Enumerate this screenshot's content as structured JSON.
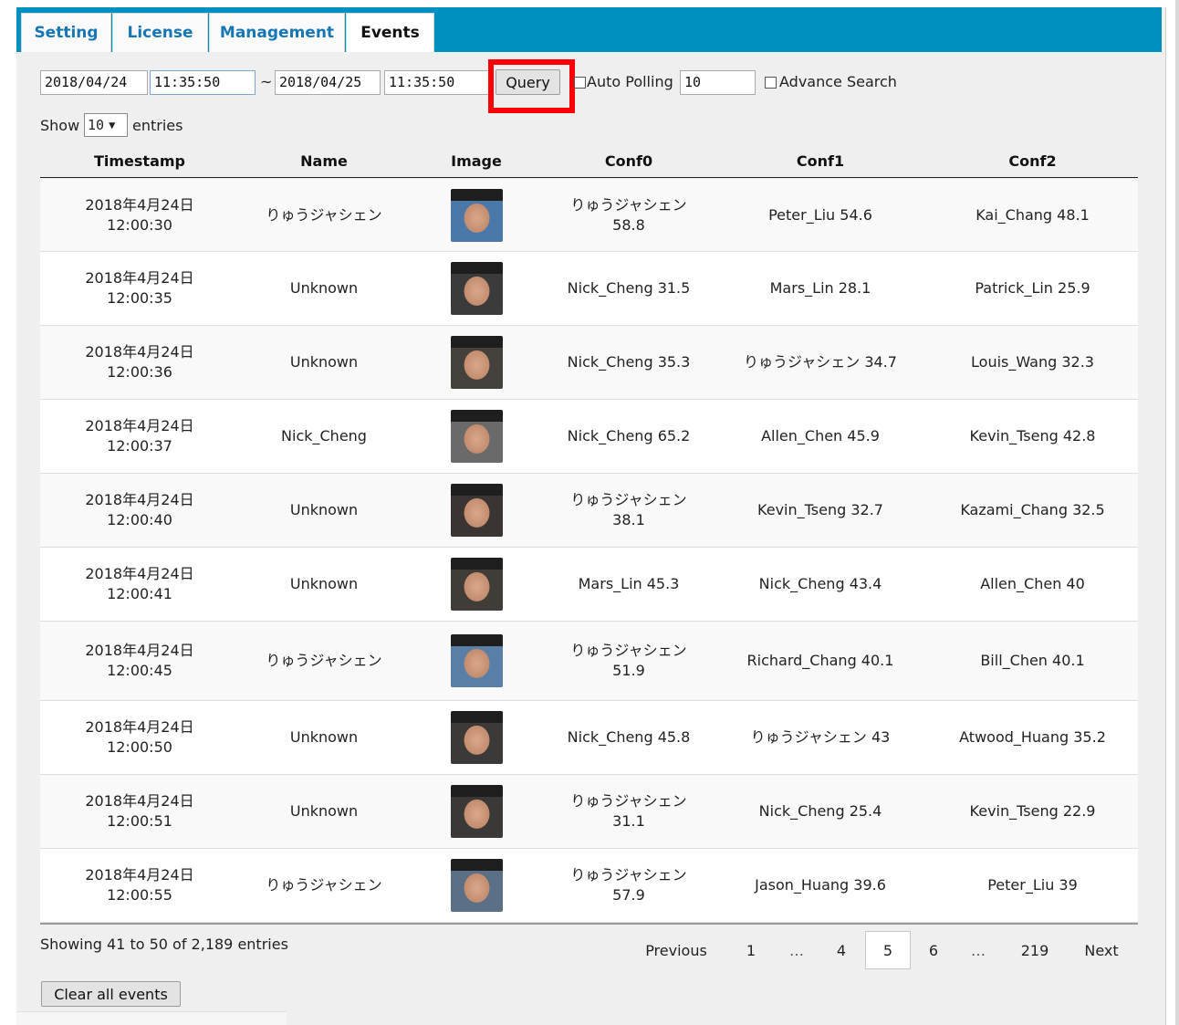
{
  "tabs": [
    {
      "label": "Setting",
      "active": false
    },
    {
      "label": "License",
      "active": false
    },
    {
      "label": "Management",
      "active": false
    },
    {
      "label": "Events",
      "active": true
    }
  ],
  "filters": {
    "start_date": "2018/04/24",
    "start_time": "11:35:50",
    "separator": "~",
    "end_date": "2018/04/25",
    "end_time": "11:35:50",
    "query_label": "Query",
    "auto_polling_label": "Auto Polling",
    "auto_polling_checked": false,
    "auto_polling_value": "10",
    "advance_search_label": "Advance Search",
    "advance_search_checked": false
  },
  "length_menu": {
    "show_label": "Show",
    "selected": "10",
    "entries_label": "entries"
  },
  "table": {
    "columns": [
      "Timestamp",
      "Name",
      "Image",
      "Conf0",
      "Conf1",
      "Conf2"
    ],
    "rows": [
      {
        "date": "2018年4月24日",
        "time": "12:00:30",
        "name": "りゅうジャシェン",
        "face_color": "#4a78a8",
        "conf0": "りゅうジャシェン\n58.8",
        "conf1": "Peter_Liu 54.6",
        "conf2": "Kai_Chang 48.1"
      },
      {
        "date": "2018年4月24日",
        "time": "12:00:35",
        "name": "Unknown",
        "face_color": "#3b3b3b",
        "conf0": "Nick_Cheng 31.5",
        "conf1": "Mars_Lin 28.1",
        "conf2": "Patrick_Lin 25.9"
      },
      {
        "date": "2018年4月24日",
        "time": "12:00:36",
        "name": "Unknown",
        "face_color": "#44413c",
        "conf0": "Nick_Cheng 35.3",
        "conf1": "りゅうジャシェン 34.7",
        "conf2": "Louis_Wang 32.3"
      },
      {
        "date": "2018年4月24日",
        "time": "12:00:37",
        "name": "Nick_Cheng",
        "face_color": "#6a6a6a",
        "conf0": "Nick_Cheng 65.2",
        "conf1": "Allen_Chen 45.9",
        "conf2": "Kevin_Tseng 42.8"
      },
      {
        "date": "2018年4月24日",
        "time": "12:00:40",
        "name": "Unknown",
        "face_color": "#3a3532",
        "conf0": "りゅうジャシェン\n38.1",
        "conf1": "Kevin_Tseng 32.7",
        "conf2": "Kazami_Chang 32.5"
      },
      {
        "date": "2018年4月24日",
        "time": "12:00:41",
        "name": "Unknown",
        "face_color": "#403c38",
        "conf0": "Mars_Lin 45.3",
        "conf1": "Nick_Cheng 43.4",
        "conf2": "Allen_Chen 40"
      },
      {
        "date": "2018年4月24日",
        "time": "12:00:45",
        "name": "りゅうジャシェン",
        "face_color": "#5a7fa6",
        "conf0": "りゅうジャシェン\n51.9",
        "conf1": "Richard_Chang 40.1",
        "conf2": "Bill_Chen 40.1"
      },
      {
        "date": "2018年4月24日",
        "time": "12:00:50",
        "name": "Unknown",
        "face_color": "#3c3a38",
        "conf0": "Nick_Cheng 45.8",
        "conf1": "りゅうジャシェン 43",
        "conf2": "Atwood_Huang 35.2"
      },
      {
        "date": "2018年4月24日",
        "time": "12:00:51",
        "name": "Unknown",
        "face_color": "#3a3938",
        "conf0": "りゅうジャシェン\n31.1",
        "conf1": "Nick_Cheng 25.4",
        "conf2": "Kevin_Tseng 22.9"
      },
      {
        "date": "2018年4月24日",
        "time": "12:00:55",
        "name": "りゅうジャシェン",
        "face_color": "#5b6f86",
        "conf0": "りゅうジャシェン\n57.9",
        "conf1": "Jason_Huang 39.6",
        "conf2": "Peter_Liu 39"
      }
    ]
  },
  "info": "Showing 41 to 50 of 2,189 entries",
  "pagination": {
    "previous": "Previous",
    "pages": [
      "1",
      "…",
      "4",
      "5",
      "6",
      "…",
      "219"
    ],
    "current": "5",
    "next": "Next"
  },
  "clear_label": "Clear all events",
  "colors": {
    "tabbar": "#0090c0",
    "tab_text": "#1777b5",
    "highlight": "#ff0000",
    "background": "#efefef"
  }
}
